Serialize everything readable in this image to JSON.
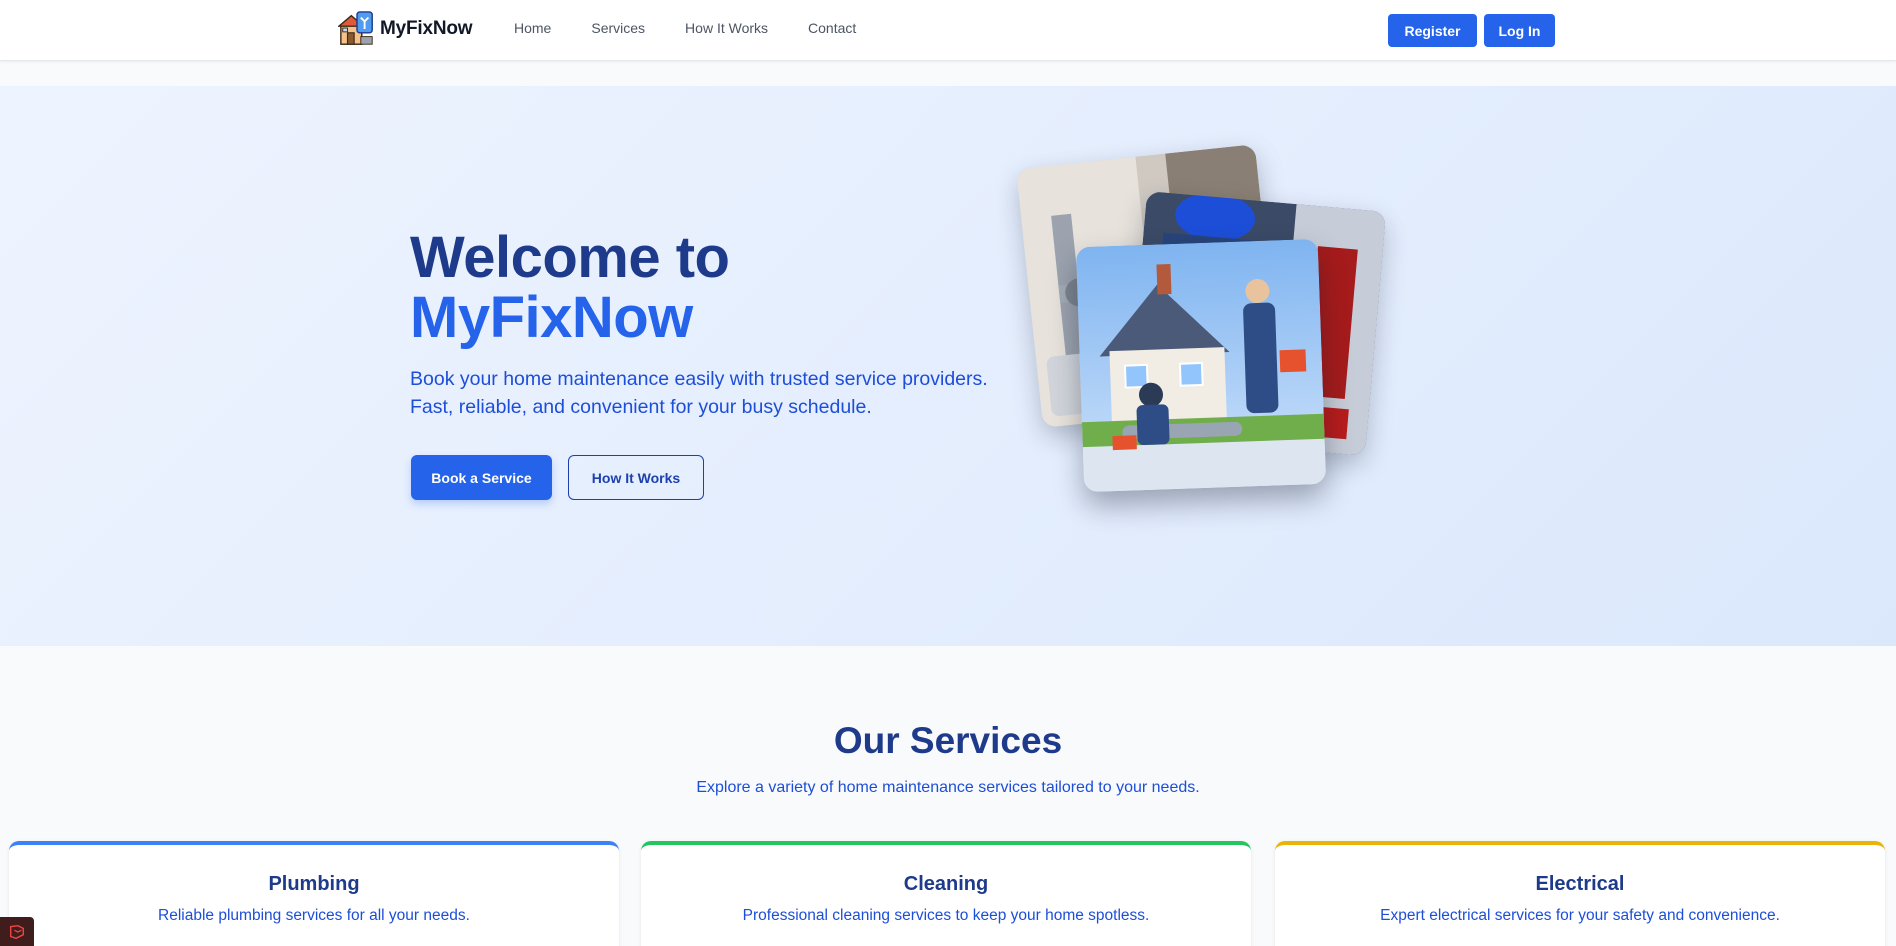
{
  "nav": {
    "brand": "MyFixNow",
    "links": [
      "Home",
      "Services",
      "How It Works",
      "Contact"
    ],
    "register_label": "Register",
    "login_label": "Log In"
  },
  "hero": {
    "title_line1": "Welcome to",
    "title_line2": "MyFixNow",
    "subtitle": "Book your home maintenance easily with trusted service providers. Fast, reliable, and convenient for your busy schedule.",
    "primary_button": "Book a Service",
    "secondary_button": "How It Works"
  },
  "services": {
    "title": "Our Services",
    "subtitle": "Explore a variety of home maintenance services tailored to your needs.",
    "cards": [
      {
        "name": "Plumbing",
        "description": "Reliable plumbing services for all your needs.",
        "accent": "#3b82f6"
      },
      {
        "name": "Cleaning",
        "description": "Professional cleaning services to keep your home spotless.",
        "accent": "#22c55e"
      },
      {
        "name": "Electrical",
        "description": "Expert electrical services for your safety and convenience.",
        "accent": "#eab308"
      }
    ]
  },
  "colors": {
    "primary": "#2563eb",
    "heading": "#1e3a8a",
    "hero_bg": "#e6effd"
  }
}
